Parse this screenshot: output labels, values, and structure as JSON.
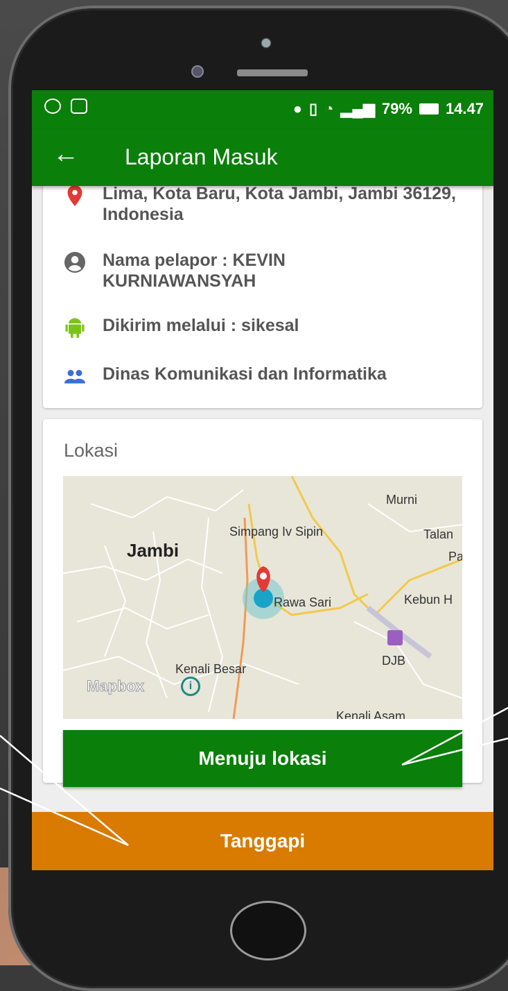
{
  "status_bar": {
    "battery": "79%",
    "time": "14.47"
  },
  "app_bar": {
    "title": "Laporan Masuk"
  },
  "details": {
    "address": "Lima, Kota Baru, Kota Jambi, Jambi 36129, Indonesia",
    "reporter": "Nama pelapor : KEVIN KURNIAWANSYAH",
    "sent_via": "Dikirim melalui : sikesal",
    "agency": "Dinas Komunikasi dan Informatika"
  },
  "location": {
    "heading": "Lokasi",
    "map_labels": {
      "murni": "Murni",
      "simpang": "Simpang Iv Sipin",
      "talan": "Talan",
      "pa": "Pa",
      "jambi": "Jambi",
      "rawa_sari": "Rawa Sari",
      "kebun": "Kebun H",
      "djb": "DJB",
      "kenali_besar": "Kenali Besar",
      "kenali_asam": "Kenali Asam",
      "mapbox": "Mapbox",
      "info": "i"
    },
    "button_label": "Menuju lokasi"
  },
  "footer": {
    "button_label": "Tanggapi"
  },
  "colors": {
    "primary": "#0a7f0a",
    "accent": "#d97b00",
    "pin": "#e53935",
    "android": "#7cc319",
    "people": "#3b6fd6"
  },
  "icons": {
    "pin": "location-pin-icon",
    "account": "account-circle-icon",
    "android": "android-icon",
    "people": "people-icon"
  }
}
